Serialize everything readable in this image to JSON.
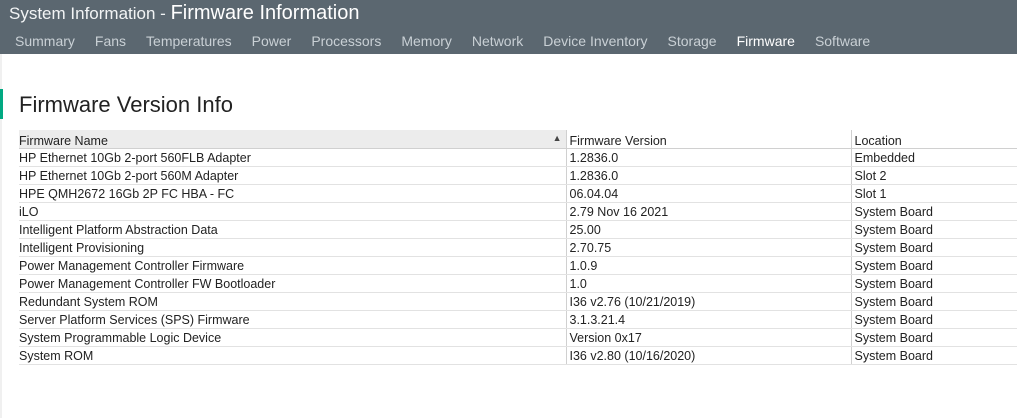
{
  "header": {
    "app_title": "System Information",
    "separator": " - ",
    "page_title": "Firmware Information"
  },
  "tabs": [
    {
      "label": "Summary",
      "active": false
    },
    {
      "label": "Fans",
      "active": false
    },
    {
      "label": "Temperatures",
      "active": false
    },
    {
      "label": "Power",
      "active": false
    },
    {
      "label": "Processors",
      "active": false
    },
    {
      "label": "Memory",
      "active": false
    },
    {
      "label": "Network",
      "active": false
    },
    {
      "label": "Device Inventory",
      "active": false
    },
    {
      "label": "Storage",
      "active": false
    },
    {
      "label": "Firmware",
      "active": true
    },
    {
      "label": "Software",
      "active": false
    }
  ],
  "section": {
    "title": "Firmware Version Info"
  },
  "table": {
    "columns": {
      "name": "Firmware Name",
      "version": "Firmware Version",
      "location": "Location"
    },
    "sort_icon": "sort-ascending-icon",
    "rows": [
      {
        "name": "HP Ethernet 10Gb 2-port 560FLB Adapter",
        "version": "1.2836.0",
        "location": "Embedded"
      },
      {
        "name": "HP Ethernet 10Gb 2-port 560M Adapter",
        "version": "1.2836.0",
        "location": "Slot 2"
      },
      {
        "name": "HPE QMH2672 16Gb 2P FC HBA - FC",
        "version": "06.04.04",
        "location": "Slot 1"
      },
      {
        "name": "iLO",
        "version": "2.79 Nov 16 2021",
        "location": "System Board"
      },
      {
        "name": "Intelligent Platform Abstraction Data",
        "version": "25.00",
        "location": "System Board"
      },
      {
        "name": "Intelligent Provisioning",
        "version": "2.70.75",
        "location": "System Board"
      },
      {
        "name": "Power Management Controller Firmware",
        "version": "1.0.9",
        "location": "System Board"
      },
      {
        "name": "Power Management Controller FW Bootloader",
        "version": "1.0",
        "location": "System Board"
      },
      {
        "name": "Redundant System ROM",
        "version": "I36 v2.76 (10/21/2019)",
        "location": "System Board"
      },
      {
        "name": "Server Platform Services (SPS) Firmware",
        "version": "3.1.3.21.4",
        "location": "System Board"
      },
      {
        "name": "System Programmable Logic Device",
        "version": "Version 0x17",
        "location": "System Board"
      },
      {
        "name": "System ROM",
        "version": "I36 v2.80 (10/16/2020)",
        "location": "System Board"
      }
    ]
  },
  "colors": {
    "header_bg": "#5b6770",
    "accent": "#01a982"
  }
}
